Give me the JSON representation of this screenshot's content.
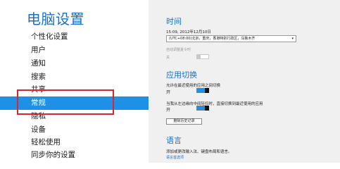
{
  "sidebar": {
    "title": "电脑设置",
    "items": [
      {
        "label": "个性化设置"
      },
      {
        "label": "用户"
      },
      {
        "label": "通知"
      },
      {
        "label": "搜索"
      },
      {
        "label": "共享"
      },
      {
        "label": "常规"
      },
      {
        "label": "隐私"
      },
      {
        "label": "设备"
      },
      {
        "label": "轻松使用"
      },
      {
        "label": "同步你的设置"
      }
    ],
    "selected_label": "常规"
  },
  "time": {
    "title": "时间",
    "datetime": "15:09, 2012年12月10日",
    "timezone": "(UTC+08:00)北京，重庆，香港特别行政区，乌鲁木齐",
    "auto_dst_label": "自动调整夏令时",
    "auto_dst_state": "关"
  },
  "app_switching": {
    "title": "应用切换",
    "option1_label": "允许在最近使用的应用之间切换",
    "option1_state": "开",
    "option2_label": "当我从左边缘向中间轻扫时，直接切换到最近使用的应用",
    "option2_state": "开",
    "clear_history_button": "删除历史记录"
  },
  "language": {
    "title": "语言",
    "description": "添加或更改输入法、键盘布局和语言。",
    "link": "语言首选项"
  },
  "colors": {
    "accent": "#1e90e6",
    "title_blue": "#1a70c8",
    "highlight_red": "#d9262c",
    "content_bg": "#f0f0f0"
  }
}
